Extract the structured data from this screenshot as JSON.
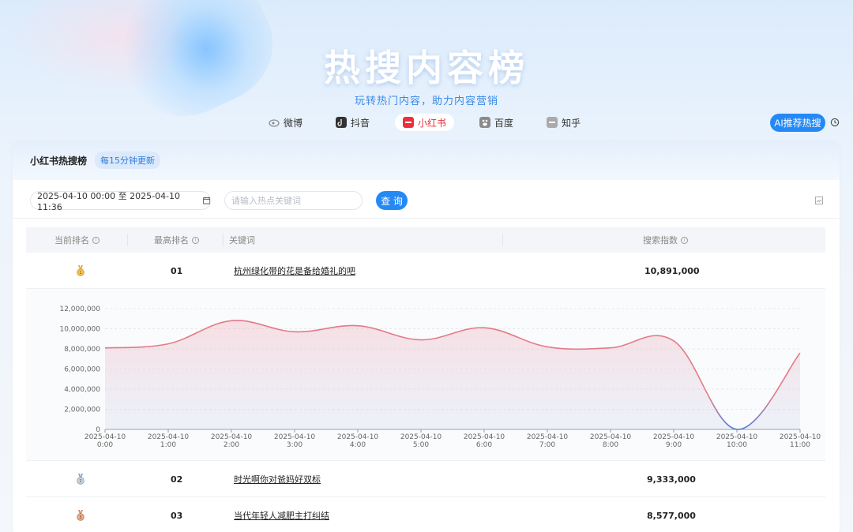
{
  "hero": {
    "title": "热搜内容榜",
    "subtitle": "玩转热门内容，助力内容营销"
  },
  "platforms": [
    {
      "label": "微博",
      "icon": "weibo-icon",
      "color": "#999999",
      "active": false
    },
    {
      "label": "抖音",
      "icon": "douyin-icon",
      "color": "#333333",
      "active": false
    },
    {
      "label": "小红书",
      "icon": "xiaohongshu-icon",
      "color": "#e8313b",
      "active": true
    },
    {
      "label": "百度",
      "icon": "baidu-icon",
      "color": "#888888",
      "active": false
    },
    {
      "label": "知乎",
      "icon": "zhihu-icon",
      "color": "#999999",
      "active": false
    }
  ],
  "ai_button": "AI推荐热搜",
  "card": {
    "title": "小红书热搜榜",
    "badge": "每15分钟更新"
  },
  "filters": {
    "date_range": "2025-04-10 00:00 至 2025-04-10 11:36",
    "search_placeholder": "请输入热点关键词",
    "query_button": "查 询"
  },
  "table": {
    "headers": [
      "当前排名",
      "最高排名",
      "关键词",
      "搜索指数"
    ],
    "rows": [
      {
        "rank_medal": "gold-medal-icon",
        "peak": "01",
        "keyword": "杭州绿化带的花是备给婚礼的吧",
        "index": "10,891,000"
      },
      {
        "rank_medal": "silver-medal-icon",
        "peak": "02",
        "keyword": "时光啊你对爸妈好双标",
        "index": "9,333,000"
      },
      {
        "rank_medal": "bronze-medal-icon",
        "peak": "03",
        "keyword": "当代年轻人减肥主打纠结",
        "index": "8,577,000"
      }
    ]
  },
  "chart_data": {
    "type": "area",
    "x": [
      "2025-04-10 0:00",
      "2025-04-10 1:00",
      "2025-04-10 2:00",
      "2025-04-10 3:00",
      "2025-04-10 4:00",
      "2025-04-10 5:00",
      "2025-04-10 6:00",
      "2025-04-10 7:00",
      "2025-04-10 8:00",
      "2025-04-10 9:00",
      "2025-04-10 10:00",
      "2025-04-10 11:00"
    ],
    "x_tick_dates": [
      "2025-04-10",
      "2025-04-10",
      "2025-04-10",
      "2025-04-10",
      "2025-04-10",
      "2025-04-10",
      "2025-04-10",
      "2025-04-10",
      "2025-04-10",
      "2025-04-10",
      "2025-04-10",
      "2025-04-10"
    ],
    "x_tick_times": [
      "0:00",
      "1:00",
      "2:00",
      "3:00",
      "4:00",
      "5:00",
      "6:00",
      "7:00",
      "8:00",
      "9:00",
      "10:00",
      "11:00"
    ],
    "values": [
      8100000,
      8500000,
      10800000,
      9700000,
      10300000,
      8900000,
      10100000,
      8200000,
      8100000,
      8800000,
      0,
      7600000
    ],
    "ylim": [
      0,
      12000000
    ],
    "yticks": [
      "0",
      "2,000,000",
      "4,000,000",
      "6,000,000",
      "8,000,000",
      "10,000,000",
      "12,000,000"
    ],
    "ytick_values": [
      0,
      2000000,
      4000000,
      6000000,
      8000000,
      10000000,
      12000000
    ],
    "grid": true,
    "line_color": "#e57a87",
    "line_color_low": "#4a7fe0"
  }
}
